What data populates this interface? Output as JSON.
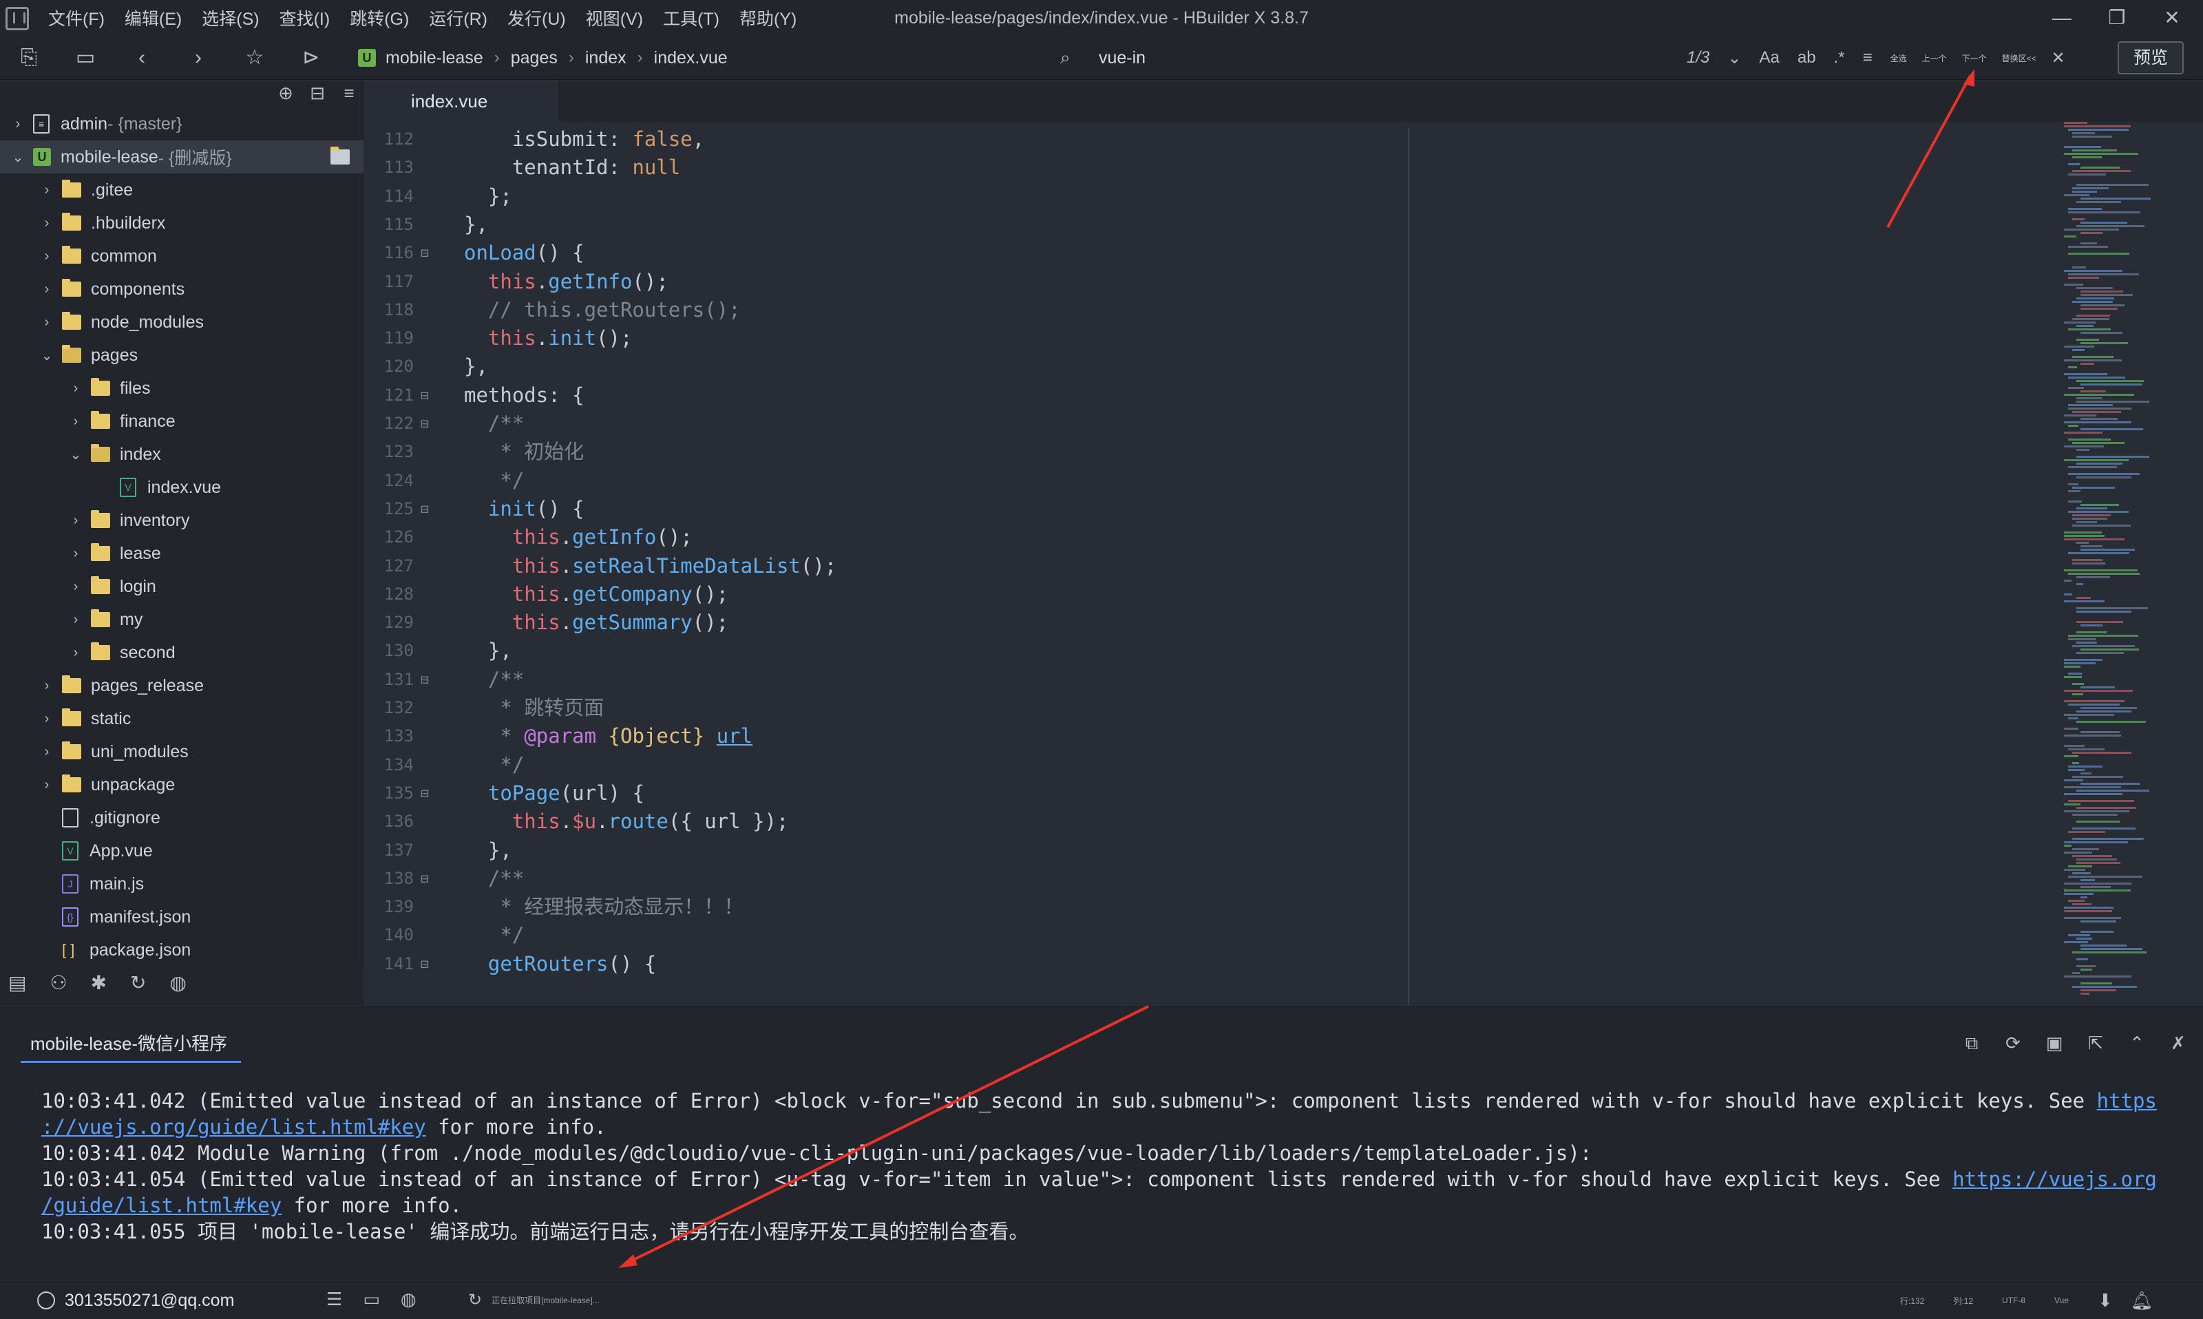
{
  "window": {
    "title": "mobile-lease/pages/index/index.vue - HBuilder X 3.8.7",
    "menu": [
      "文件(F)",
      "编辑(E)",
      "选择(S)",
      "查找(I)",
      "跳转(G)",
      "运行(R)",
      "发行(U)",
      "视图(V)",
      "工具(T)",
      "帮助(Y)"
    ],
    "controls": {
      "minimize": "—",
      "restore": "❐",
      "close": "✕"
    }
  },
  "toolbar": {
    "breadcrumb": [
      "mobile-lease",
      "pages",
      "index",
      "index.vue"
    ],
    "find_query": "vue-in",
    "find_count": "1/3",
    "find_buttons": [
      "全选",
      "上一个",
      "下一个",
      "替换区<<"
    ],
    "preview_label": "预览"
  },
  "sidebar": {
    "tree": [
      {
        "label": "admin",
        "branch": " - {master}",
        "type": "project",
        "indent": 0,
        "state": "closed"
      },
      {
        "label": "mobile-lease",
        "branch": " - {删减版}",
        "type": "uni-project",
        "indent": 0,
        "state": "open"
      },
      {
        "label": ".gitee",
        "type": "folder",
        "indent": 1,
        "state": "closed"
      },
      {
        "label": ".hbuilderx",
        "type": "folder",
        "indent": 1,
        "state": "closed"
      },
      {
        "label": "common",
        "type": "folder",
        "indent": 1,
        "state": "closed"
      },
      {
        "label": "components",
        "type": "folder",
        "indent": 1,
        "state": "closed"
      },
      {
        "label": "node_modules",
        "type": "folder",
        "indent": 1,
        "state": "closed"
      },
      {
        "label": "pages",
        "type": "folder",
        "indent": 1,
        "state": "open"
      },
      {
        "label": "files",
        "type": "folder",
        "indent": 2,
        "state": "closed"
      },
      {
        "label": "finance",
        "type": "folder",
        "indent": 2,
        "state": "closed"
      },
      {
        "label": "index",
        "type": "folder",
        "indent": 2,
        "state": "open"
      },
      {
        "label": "index.vue",
        "type": "vue",
        "indent": 3,
        "state": "leaf"
      },
      {
        "label": "inventory",
        "type": "folder",
        "indent": 2,
        "state": "closed"
      },
      {
        "label": "lease",
        "type": "folder",
        "indent": 2,
        "state": "closed"
      },
      {
        "label": "login",
        "type": "folder",
        "indent": 2,
        "state": "closed"
      },
      {
        "label": "my",
        "type": "folder",
        "indent": 2,
        "state": "closed"
      },
      {
        "label": "second",
        "type": "folder",
        "indent": 2,
        "state": "closed"
      },
      {
        "label": "pages_release",
        "type": "folder",
        "indent": 1,
        "state": "closed"
      },
      {
        "label": "static",
        "type": "folder",
        "indent": 1,
        "state": "closed"
      },
      {
        "label": "uni_modules",
        "type": "folder",
        "indent": 1,
        "state": "closed"
      },
      {
        "label": "unpackage",
        "type": "folder",
        "indent": 1,
        "state": "closed"
      },
      {
        "label": ".gitignore",
        "type": "file",
        "indent": 1,
        "state": "leaf"
      },
      {
        "label": "App.vue",
        "type": "vue",
        "indent": 1,
        "state": "leaf"
      },
      {
        "label": "main.js",
        "type": "js",
        "indent": 1,
        "state": "leaf"
      },
      {
        "label": "manifest.json",
        "type": "json",
        "indent": 1,
        "state": "leaf"
      },
      {
        "label": "package.json",
        "type": "pkg",
        "indent": 1,
        "state": "leaf"
      }
    ]
  },
  "editor": {
    "tab": "index.vue",
    "lines": [
      {
        "n": "112",
        "fold": "",
        "html": "    <span class='p'>isSubmit</span>: <span class='v'>false</span>,"
      },
      {
        "n": "113",
        "fold": "",
        "html": "    <span class='p'>tenantId</span>: <span class='v'>null</span>"
      },
      {
        "n": "114",
        "fold": "",
        "html": "  };"
      },
      {
        "n": "115",
        "fold": "",
        "html": "},"
      },
      {
        "n": "116",
        "fold": "⊟",
        "html": "<span class='f'>onLoad</span>() {"
      },
      {
        "n": "117",
        "fold": "",
        "html": "  <span class='t'>this</span>.<span class='f'>getInfo</span>();"
      },
      {
        "n": "118",
        "fold": "",
        "html": "  <span class='c'>// this.getRouters();</span>"
      },
      {
        "n": "119",
        "fold": "",
        "html": "  <span class='t'>this</span>.<span class='f'>init</span>();"
      },
      {
        "n": "120",
        "fold": "",
        "html": "},"
      },
      {
        "n": "121",
        "fold": "⊟",
        "html": "<span class='p'>methods</span>: {"
      },
      {
        "n": "122",
        "fold": "⊟",
        "html": "  <span class='c'>/**</span>"
      },
      {
        "n": "123",
        "fold": "",
        "html": "  <span class='c'> * 初始化</span>"
      },
      {
        "n": "124",
        "fold": "",
        "html": "  <span class='c'> */</span>"
      },
      {
        "n": "125",
        "fold": "⊟",
        "html": "  <span class='f'>init</span>() {"
      },
      {
        "n": "126",
        "fold": "",
        "html": "    <span class='t'>this</span>.<span class='f'>getInfo</span>();"
      },
      {
        "n": "127",
        "fold": "",
        "html": "    <span class='t'>this</span>.<span class='f'>setRealTimeDataList</span>();"
      },
      {
        "n": "128",
        "fold": "",
        "html": "    <span class='t'>this</span>.<span class='f'>getCompany</span>();"
      },
      {
        "n": "129",
        "fold": "",
        "html": "    <span class='t'>this</span>.<span class='f'>getSummary</span>();"
      },
      {
        "n": "130",
        "fold": "",
        "html": "  },"
      },
      {
        "n": "131",
        "fold": "⊟",
        "html": "  <span class='c'>/**</span>"
      },
      {
        "n": "132",
        "fold": "",
        "html": "  <span class='c'> * 跳转页面</span>"
      },
      {
        "n": "133",
        "fold": "",
        "html": "  <span class='c'> * </span><span class='kw'>@param</span> <span class='o'>{Object}</span> <span class='u'>url</span>"
      },
      {
        "n": "134",
        "fold": "",
        "html": "  <span class='c'> */</span>"
      },
      {
        "n": "135",
        "fold": "⊟",
        "html": "  <span class='f'>toPage</span>(url) {"
      },
      {
        "n": "136",
        "fold": "",
        "html": "    <span class='t'>this</span>.<span class='t'>$u</span>.<span class='f'>route</span>({ url });"
      },
      {
        "n": "137",
        "fold": "",
        "html": "  },"
      },
      {
        "n": "138",
        "fold": "⊟",
        "html": "  <span class='c'>/**</span>"
      },
      {
        "n": "139",
        "fold": "",
        "html": "  <span class='c'> * 经理报表动态显示！！！</span>"
      },
      {
        "n": "140",
        "fold": "",
        "html": "  <span class='c'> */</span>"
      },
      {
        "n": "141",
        "fold": "⊟",
        "html": "  <span class='f'>getRouters</span>() {"
      }
    ]
  },
  "console": {
    "tab": "mobile-lease-微信小程序",
    "lines": [
      {
        "parts": [
          {
            "t": "10:03:41.042 (Emitted value instead of an instance of Error) <block v-for=\"sub_second in sub.submenu\">: component lists rendered with v-for should have explicit keys. See "
          },
          {
            "t": "https",
            "link": true
          }
        ]
      },
      {
        "parts": [
          {
            "t": "://vuejs.org/guide/list.html#key",
            "link": true
          },
          {
            "t": " for more info."
          }
        ]
      },
      {
        "parts": [
          {
            "t": "10:03:41.042 Module Warning (from ./node_modules/@dcloudio/vue-cli-plugin-uni/packages/vue-loader/lib/loaders/templateLoader.js):"
          }
        ]
      },
      {
        "parts": [
          {
            "t": "10:03:41.054 (Emitted value instead of an instance of Error) <u-tag v-for=\"item in value\">: component lists rendered with v-for should have explicit keys. See "
          },
          {
            "t": "https://vuejs.org",
            "link": true
          }
        ]
      },
      {
        "parts": [
          {
            "t": "/guide/list.html#key",
            "link": true
          },
          {
            "t": " for more info."
          }
        ]
      },
      {
        "parts": [
          {
            "t": "10:03:41.055 项目 'mobile-lease' 编译成功。前端运行日志，请另行在小程序开发工具的控制台查看。"
          }
        ]
      }
    ]
  },
  "statusbar": {
    "user": "3013550271@qq.com",
    "message": "正在拉取项目[mobile-lease]...",
    "position": "行:132",
    "column": "列:12",
    "encoding": "UTF-8",
    "language": "Vue"
  }
}
